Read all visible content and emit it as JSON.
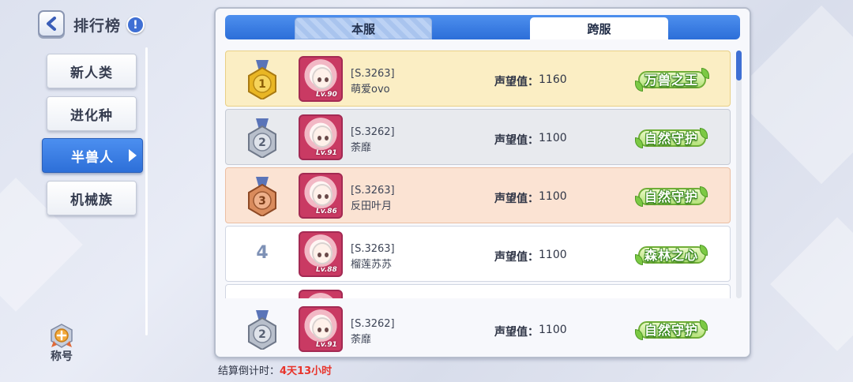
{
  "header": {
    "title": "排行榜",
    "info_icon": "!"
  },
  "categories": [
    {
      "label": "新人类",
      "active": false
    },
    {
      "label": "进化种",
      "active": false
    },
    {
      "label": "半兽人",
      "active": true
    },
    {
      "label": "机械族",
      "active": false
    }
  ],
  "side_badge": {
    "label": "称号"
  },
  "tabs": {
    "local": "本服",
    "cross": "跨服",
    "selected": "cross"
  },
  "prestige_label": "声望值：",
  "rows": [
    {
      "rank": "1",
      "medal": "gold",
      "server": "[S.3263]",
      "name": "萌爱ovo",
      "prestige": "1160",
      "title": "万兽之王",
      "level": "Lv.90"
    },
    {
      "rank": "2",
      "medal": "silver",
      "server": "[S.3262]",
      "name": "荼靡",
      "prestige": "1100",
      "title": "自然守护",
      "level": "Lv.91"
    },
    {
      "rank": "3",
      "medal": "bronze",
      "server": "[S.3263]",
      "name": "反田叶月",
      "prestige": "1100",
      "title": "自然守护",
      "level": "Lv.86"
    },
    {
      "rank": "4",
      "medal": "none",
      "server": "[S.3263]",
      "name": "榴莲苏苏",
      "prestige": "1100",
      "title": "森林之心",
      "level": "Lv.88"
    }
  ],
  "self_row": {
    "rank": "2",
    "medal": "silver",
    "server": "[S.3262]",
    "name": "荼靡",
    "prestige": "1100",
    "title": "自然守护",
    "level": "Lv.91"
  },
  "countdown": {
    "label": "结算倒计时：",
    "value": "4天13小时"
  },
  "colors": {
    "accent_blue": "#2d6fd8",
    "gold_row": "#fbeec4",
    "silver_row": "#e8eaee",
    "bronze_row": "#fbe3d3",
    "countdown_red": "#e8342b"
  }
}
